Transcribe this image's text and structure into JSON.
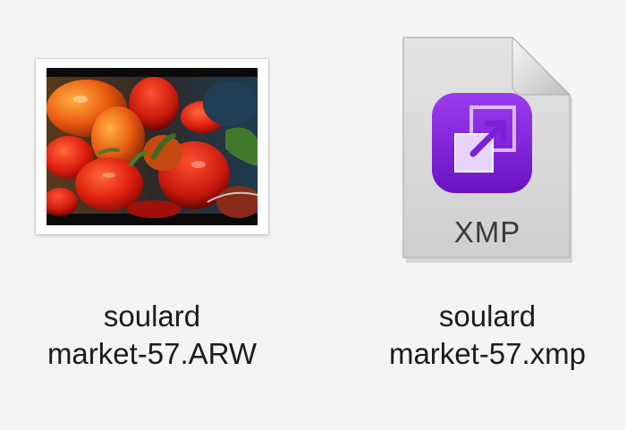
{
  "files": [
    {
      "name_line1": "soulard",
      "name_line2": "market-57.ARW",
      "icon": "photo-thumbnail-icon"
    },
    {
      "name_line1": "soulard",
      "name_line2": "market-57.xmp",
      "icon": "xmp-document-icon",
      "badge_label": "XMP"
    }
  ],
  "colors": {
    "background": "#f4f4f4",
    "xmp_badge": "#7b1fd1",
    "document": "#d9d9d9"
  }
}
